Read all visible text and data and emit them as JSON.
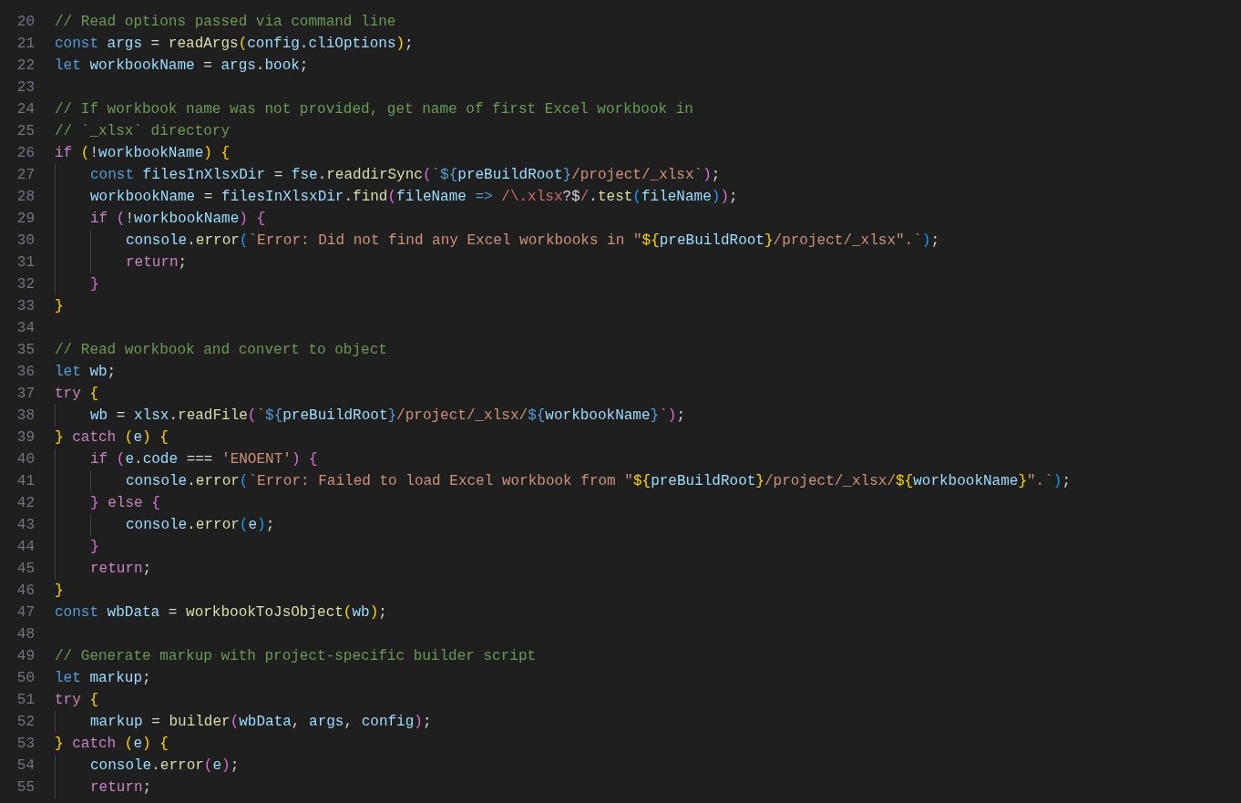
{
  "editor": {
    "lines": [
      {
        "number": "20",
        "tokens": [
          {
            "kind": "comment",
            "text": "// Read options passed via command line"
          }
        ]
      },
      {
        "number": "21",
        "tokens": [
          {
            "kind": "keyword",
            "text": "const "
          },
          {
            "kind": "variable",
            "text": "args"
          },
          {
            "kind": "plain",
            "text": " = "
          },
          {
            "kind": "function",
            "text": "readArgs"
          },
          {
            "kind": "bracket1",
            "text": "("
          },
          {
            "kind": "variable",
            "text": "config"
          },
          {
            "kind": "plain",
            "text": "."
          },
          {
            "kind": "variable",
            "text": "cliOptions"
          },
          {
            "kind": "bracket1",
            "text": ")"
          },
          {
            "kind": "plain",
            "text": ";"
          }
        ]
      },
      {
        "number": "22",
        "tokens": [
          {
            "kind": "keyword",
            "text": "let "
          },
          {
            "kind": "variable",
            "text": "workbookName"
          },
          {
            "kind": "plain",
            "text": " = "
          },
          {
            "kind": "variable",
            "text": "args"
          },
          {
            "kind": "plain",
            "text": "."
          },
          {
            "kind": "variable",
            "text": "book"
          },
          {
            "kind": "plain",
            "text": ";"
          }
        ]
      },
      {
        "number": "23"
      },
      {
        "number": "24",
        "tokens": [
          {
            "kind": "comment",
            "text": "// If workbook name was not provided, get name of first Excel workbook in"
          }
        ]
      },
      {
        "number": "25",
        "tokens": [
          {
            "kind": "comment",
            "text": "// `_xlsx` directory"
          }
        ]
      },
      {
        "number": "26",
        "tokens": [
          {
            "kind": "control",
            "text": "if "
          },
          {
            "kind": "bracket1",
            "text": "("
          },
          {
            "kind": "plain",
            "text": "!"
          },
          {
            "kind": "variable",
            "text": "workbookName"
          },
          {
            "kind": "bracket1",
            "text": ") "
          },
          {
            "kind": "bracket1",
            "text": "{"
          }
        ],
        "children": [
          {
            "number": "27",
            "tokens": [
              {
                "kind": "keyword",
                "text": "const "
              },
              {
                "kind": "variable",
                "text": "filesInXlsxDir"
              },
              {
                "kind": "plain",
                "text": " = "
              },
              {
                "kind": "variable",
                "text": "fse"
              },
              {
                "kind": "plain",
                "text": "."
              },
              {
                "kind": "function",
                "text": "readdirSync"
              },
              {
                "kind": "bracket2",
                "text": "("
              },
              {
                "kind": "string",
                "text": "`"
              },
              {
                "kind": "template",
                "text": "${"
              },
              {
                "kind": "variable",
                "text": "preBuildRoot"
              },
              {
                "kind": "template",
                "text": "}"
              },
              {
                "kind": "string",
                "text": "/project/_xlsx`"
              },
              {
                "kind": "bracket2",
                "text": ")"
              },
              {
                "kind": "plain",
                "text": ";"
              }
            ]
          },
          {
            "number": "28",
            "tokens": [
              {
                "kind": "variable",
                "text": "workbookName"
              },
              {
                "kind": "plain",
                "text": " = "
              },
              {
                "kind": "variable",
                "text": "filesInXlsxDir"
              },
              {
                "kind": "plain",
                "text": "."
              },
              {
                "kind": "function",
                "text": "find"
              },
              {
                "kind": "bracket2",
                "text": "("
              },
              {
                "kind": "variable",
                "text": "fileName"
              },
              {
                "kind": "keyword",
                "text": " => "
              },
              {
                "kind": "regex",
                "text": "/\\.xlsx"
              },
              {
                "kind": "plain",
                "text": "?$"
              },
              {
                "kind": "regex",
                "text": "/"
              },
              {
                "kind": "plain",
                "text": "."
              },
              {
                "kind": "function",
                "text": "test"
              },
              {
                "kind": "bracket3",
                "text": "("
              },
              {
                "kind": "variable",
                "text": "fileName"
              },
              {
                "kind": "bracket3",
                "text": ")"
              },
              {
                "kind": "bracket2",
                "text": ")"
              },
              {
                "kind": "plain",
                "text": ";"
              }
            ]
          },
          {
            "number": "29",
            "tokens": [
              {
                "kind": "control",
                "text": "if "
              },
              {
                "kind": "bracket2",
                "text": "("
              },
              {
                "kind": "plain",
                "text": "!"
              },
              {
                "kind": "variable",
                "text": "workbookName"
              },
              {
                "kind": "bracket2",
                "text": ") "
              },
              {
                "kind": "bracket2",
                "text": "{"
              }
            ],
            "children": [
              {
                "number": "30",
                "tokens": [
                  {
                    "kind": "variable",
                    "text": "console"
                  },
                  {
                    "kind": "plain",
                    "text": "."
                  },
                  {
                    "kind": "function",
                    "text": "error"
                  },
                  {
                    "kind": "bracket3",
                    "text": "("
                  },
                  {
                    "kind": "string",
                    "text": "`Error: Did not find any Excel workbooks in \""
                  },
                  {
                    "kind": "bracket1",
                    "text": "${"
                  },
                  {
                    "kind": "variable",
                    "text": "preBuildRoot"
                  },
                  {
                    "kind": "bracket1",
                    "text": "}"
                  },
                  {
                    "kind": "string",
                    "text": "/project/_xlsx\".`"
                  },
                  {
                    "kind": "bracket3",
                    "text": ")"
                  },
                  {
                    "kind": "plain",
                    "text": ";"
                  }
                ]
              },
              {
                "number": "31",
                "tokens": [
                  {
                    "kind": "control",
                    "text": "return"
                  },
                  {
                    "kind": "plain",
                    "text": ";"
                  }
                ]
              }
            ]
          },
          {
            "number": "32",
            "tokens": [
              {
                "kind": "bracket2",
                "text": "}"
              }
            ]
          }
        ]
      },
      {
        "number": "33",
        "tokens": [
          {
            "kind": "bracket1",
            "text": "}"
          }
        ]
      },
      {
        "number": "34"
      },
      {
        "number": "35",
        "tokens": [
          {
            "kind": "comment",
            "text": "// Read workbook and convert to object"
          }
        ]
      },
      {
        "number": "36",
        "tokens": [
          {
            "kind": "keyword",
            "text": "let "
          },
          {
            "kind": "variable",
            "text": "wb"
          },
          {
            "kind": "plain",
            "text": ";"
          }
        ]
      },
      {
        "number": "37",
        "tokens": [
          {
            "kind": "control",
            "text": "try "
          },
          {
            "kind": "bracket1",
            "text": "{"
          }
        ],
        "children": [
          {
            "number": "38",
            "tokens": [
              {
                "kind": "variable",
                "text": "wb"
              },
              {
                "kind": "plain",
                "text": " = "
              },
              {
                "kind": "variable",
                "text": "xlsx"
              },
              {
                "kind": "plain",
                "text": "."
              },
              {
                "kind": "function",
                "text": "readFile"
              },
              {
                "kind": "bracket2",
                "text": "("
              },
              {
                "kind": "string",
                "text": "`"
              },
              {
                "kind": "template",
                "text": "${"
              },
              {
                "kind": "variable",
                "text": "preBuildRoot"
              },
              {
                "kind": "template",
                "text": "}"
              },
              {
                "kind": "string",
                "text": "/project/_xlsx/"
              },
              {
                "kind": "template",
                "text": "${"
              },
              {
                "kind": "variable",
                "text": "workbookName"
              },
              {
                "kind": "template",
                "text": "}"
              },
              {
                "kind": "string",
                "text": "`"
              },
              {
                "kind": "bracket2",
                "text": ")"
              },
              {
                "kind": "plain",
                "text": ";"
              }
            ]
          }
        ]
      },
      {
        "number": "39",
        "tokens": [
          {
            "kind": "bracket1",
            "text": "} "
          },
          {
            "kind": "control",
            "text": "catch "
          },
          {
            "kind": "bracket1",
            "text": "("
          },
          {
            "kind": "variable",
            "text": "e"
          },
          {
            "kind": "bracket1",
            "text": ") "
          },
          {
            "kind": "bracket1",
            "text": "{"
          }
        ],
        "children": [
          {
            "number": "40",
            "tokens": [
              {
                "kind": "control",
                "text": "if "
              },
              {
                "kind": "bracket2",
                "text": "("
              },
              {
                "kind": "variable",
                "text": "e"
              },
              {
                "kind": "plain",
                "text": "."
              },
              {
                "kind": "variable",
                "text": "code"
              },
              {
                "kind": "plain",
                "text": " === "
              },
              {
                "kind": "string",
                "text": "'ENOENT'"
              },
              {
                "kind": "bracket2",
                "text": ") "
              },
              {
                "kind": "bracket2",
                "text": "{"
              }
            ],
            "children": [
              {
                "number": "41",
                "tokens": [
                  {
                    "kind": "variable",
                    "text": "console"
                  },
                  {
                    "kind": "plain",
                    "text": "."
                  },
                  {
                    "kind": "function",
                    "text": "error"
                  },
                  {
                    "kind": "bracket3",
                    "text": "("
                  },
                  {
                    "kind": "string",
                    "text": "`Error: Failed to load Excel workbook from \""
                  },
                  {
                    "kind": "bracket1",
                    "text": "${"
                  },
                  {
                    "kind": "variable",
                    "text": "preBuildRoot"
                  },
                  {
                    "kind": "bracket1",
                    "text": "}"
                  },
                  {
                    "kind": "string",
                    "text": "/project/_xlsx/"
                  },
                  {
                    "kind": "bracket1",
                    "text": "${"
                  },
                  {
                    "kind": "variable",
                    "text": "workbookName"
                  },
                  {
                    "kind": "bracket1",
                    "text": "}"
                  },
                  {
                    "kind": "string",
                    "text": "\".`"
                  },
                  {
                    "kind": "bracket3",
                    "text": ")"
                  },
                  {
                    "kind": "plain",
                    "text": ";"
                  }
                ]
              }
            ]
          },
          {
            "number": "42",
            "tokens": [
              {
                "kind": "bracket2",
                "text": "} "
              },
              {
                "kind": "control",
                "text": "else "
              },
              {
                "kind": "bracket2",
                "text": "{"
              }
            ],
            "children": [
              {
                "number": "43",
                "tokens": [
                  {
                    "kind": "variable",
                    "text": "console"
                  },
                  {
                    "kind": "plain",
                    "text": "."
                  },
                  {
                    "kind": "function",
                    "text": "error"
                  },
                  {
                    "kind": "bracket3",
                    "text": "("
                  },
                  {
                    "kind": "variable",
                    "text": "e"
                  },
                  {
                    "kind": "bracket3",
                    "text": ")"
                  },
                  {
                    "kind": "plain",
                    "text": ";"
                  }
                ]
              }
            ]
          },
          {
            "number": "44",
            "tokens": [
              {
                "kind": "bracket2",
                "text": "}"
              }
            ]
          },
          {
            "number": "45",
            "tokens": [
              {
                "kind": "control",
                "text": "return"
              },
              {
                "kind": "plain",
                "text": ";"
              }
            ]
          }
        ]
      },
      {
        "number": "46",
        "tokens": [
          {
            "kind": "bracket1",
            "text": "}"
          }
        ]
      },
      {
        "number": "47",
        "tokens": [
          {
            "kind": "keyword",
            "text": "const "
          },
          {
            "kind": "variable",
            "text": "wbData"
          },
          {
            "kind": "plain",
            "text": " = "
          },
          {
            "kind": "function",
            "text": "workbookToJsObject"
          },
          {
            "kind": "bracket1",
            "text": "("
          },
          {
            "kind": "variable",
            "text": "wb"
          },
          {
            "kind": "bracket1",
            "text": ")"
          },
          {
            "kind": "plain",
            "text": ";"
          }
        ]
      },
      {
        "number": "48"
      },
      {
        "number": "49",
        "tokens": [
          {
            "kind": "comment",
            "text": "// Generate markup with project-specific builder script"
          }
        ]
      },
      {
        "number": "50",
        "tokens": [
          {
            "kind": "keyword",
            "text": "let "
          },
          {
            "kind": "variable",
            "text": "markup"
          },
          {
            "kind": "plain",
            "text": ";"
          }
        ]
      },
      {
        "number": "51",
        "tokens": [
          {
            "kind": "control",
            "text": "try "
          },
          {
            "kind": "bracket1",
            "text": "{"
          }
        ],
        "children": [
          {
            "number": "52",
            "tokens": [
              {
                "kind": "variable",
                "text": "markup"
              },
              {
                "kind": "plain",
                "text": " = "
              },
              {
                "kind": "function",
                "text": "builder"
              },
              {
                "kind": "bracket2",
                "text": "("
              },
              {
                "kind": "variable",
                "text": "wbData"
              },
              {
                "kind": "plain",
                "text": ", "
              },
              {
                "kind": "variable",
                "text": "args"
              },
              {
                "kind": "plain",
                "text": ", "
              },
              {
                "kind": "variable",
                "text": "config"
              },
              {
                "kind": "bracket2",
                "text": ")"
              },
              {
                "kind": "plain",
                "text": ";"
              }
            ]
          }
        ]
      },
      {
        "number": "53",
        "tokens": [
          {
            "kind": "bracket1",
            "text": "} "
          },
          {
            "kind": "control",
            "text": "catch "
          },
          {
            "kind": "bracket1",
            "text": "("
          },
          {
            "kind": "variable",
            "text": "e"
          },
          {
            "kind": "bracket1",
            "text": ") "
          },
          {
            "kind": "bracket1",
            "text": "{"
          }
        ],
        "children": [
          {
            "number": "54",
            "tokens": [
              {
                "kind": "variable",
                "text": "console"
              },
              {
                "kind": "plain",
                "text": "."
              },
              {
                "kind": "function",
                "text": "error"
              },
              {
                "kind": "bracket2",
                "text": "("
              },
              {
                "kind": "variable",
                "text": "e"
              },
              {
                "kind": "bracket2",
                "text": ")"
              },
              {
                "kind": "plain",
                "text": ";"
              }
            ]
          },
          {
            "number": "55",
            "tokens": [
              {
                "kind": "control",
                "text": "return"
              },
              {
                "kind": "plain",
                "text": ";"
              }
            ]
          }
        ]
      }
    ]
  }
}
